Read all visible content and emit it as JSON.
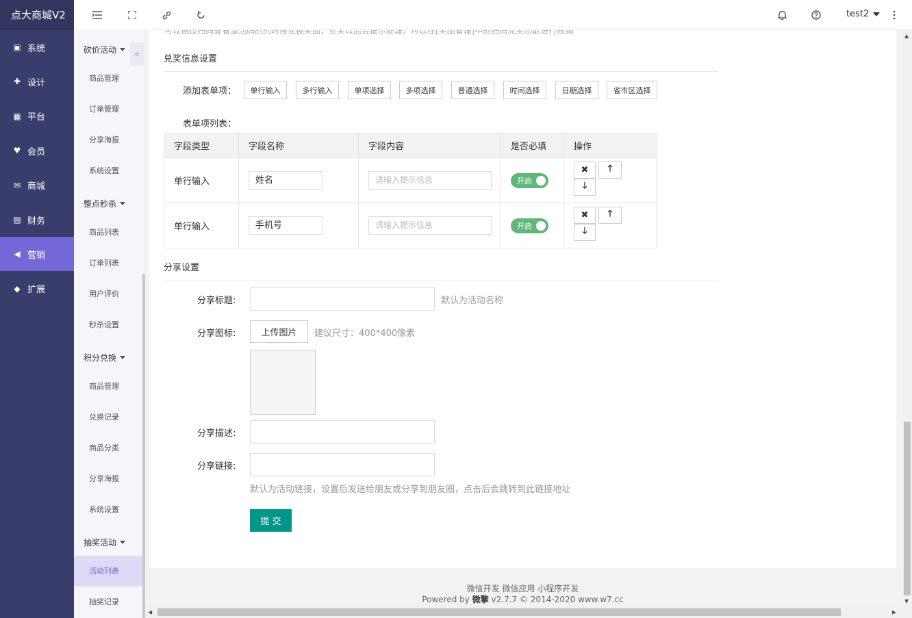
{
  "app": {
    "title": "点大商城V2"
  },
  "colors": {
    "sidebar": "#393d6b",
    "active": "#7468d8",
    "switch_on": "#5fb878",
    "submit": "#009688"
  },
  "main_nav": [
    {
      "label": "系统",
      "icon": "monitor-icon"
    },
    {
      "label": "设计",
      "icon": "puzzle-icon"
    },
    {
      "label": "平台",
      "icon": "grid-icon"
    },
    {
      "label": "会员",
      "icon": "heart-icon"
    },
    {
      "label": "商城",
      "icon": "mail-icon"
    },
    {
      "label": "财务",
      "icon": "wallet-icon"
    },
    {
      "label": "营销",
      "icon": "megaphone-icon",
      "active": true
    },
    {
      "label": "扩展",
      "icon": "box-icon"
    }
  ],
  "sub_nav": {
    "groups": [
      {
        "label": "砍价活动",
        "items": [
          "商品管理",
          "订单管理",
          "分享海报",
          "系统设置"
        ]
      },
      {
        "label": "整点秒杀",
        "items": [
          "商品列表",
          "订单列表",
          "用户评价",
          "秒杀设置"
        ]
      },
      {
        "label": "积分兑换",
        "items": [
          "商品管理",
          "兑换记录",
          "商品分类",
          "分享海报",
          "系统设置"
        ]
      },
      {
        "label": "抽奖活动",
        "items": [
          "活动列表",
          "抽奖记录"
        ]
      }
    ],
    "active_item": "活动列表",
    "collapse_icon": "double-chevron-left-icon"
  },
  "topbar": {
    "icons": [
      "menu-fold-icon",
      "fullscreen-icon",
      "link-icon",
      "refresh-icon",
      "bell-icon",
      "help-icon",
      "more-vertical-icon"
    ],
    "user": "test2"
  },
  "form": {
    "top_cut_text": "可以通过扫码查看激活码的的时候兑换奖品，兑奖以后会提示处理，可以在[奖品管理]中的扫码兑奖功能进行核销",
    "prize_section_title": "兑奖信息设置",
    "add_fields_label": "添加表单项：",
    "add_buttons": [
      "单行输入",
      "多行输入",
      "单项选择",
      "多项选择",
      "普通选择",
      "时间选择",
      "日期选择",
      "省市区选择"
    ],
    "list_label": "表单项列表：",
    "table_headers": [
      "字段类型",
      "字段名称",
      "字段内容",
      "是否必填",
      "操作"
    ],
    "rows": [
      {
        "type": "单行输入",
        "name": "姓名",
        "placeholder": "请输入提示信息",
        "required": "开启"
      },
      {
        "type": "单行输入",
        "name": "手机号",
        "placeholder": "请输入提示信息",
        "required": "开启"
      }
    ],
    "op_icons": [
      "close-icon",
      "arrow-up-icon",
      "arrow-down-icon"
    ],
    "share_section_title": "分享设置",
    "share_title_label": "分享标题:",
    "share_title_hint": "默认为活动名称",
    "share_icon_label": "分享图标:",
    "upload_label": "上传图片",
    "upload_hint": "建议尺寸：400*400像素",
    "share_desc_label": "分享描述:",
    "share_link_label": "分享链接:",
    "share_link_hint": "默认为活动链接，设置后发送给朋友或分享到朋友圈，点击后会跳转到此链接地址",
    "submit_label": "提 交"
  },
  "footer": {
    "links": "微信开发 微信应用 小程序开发",
    "powered_prefix": "Powered by ",
    "brand": "微擎",
    "version": " v2.7.7 © 2014-2020 www.w7.cc"
  }
}
